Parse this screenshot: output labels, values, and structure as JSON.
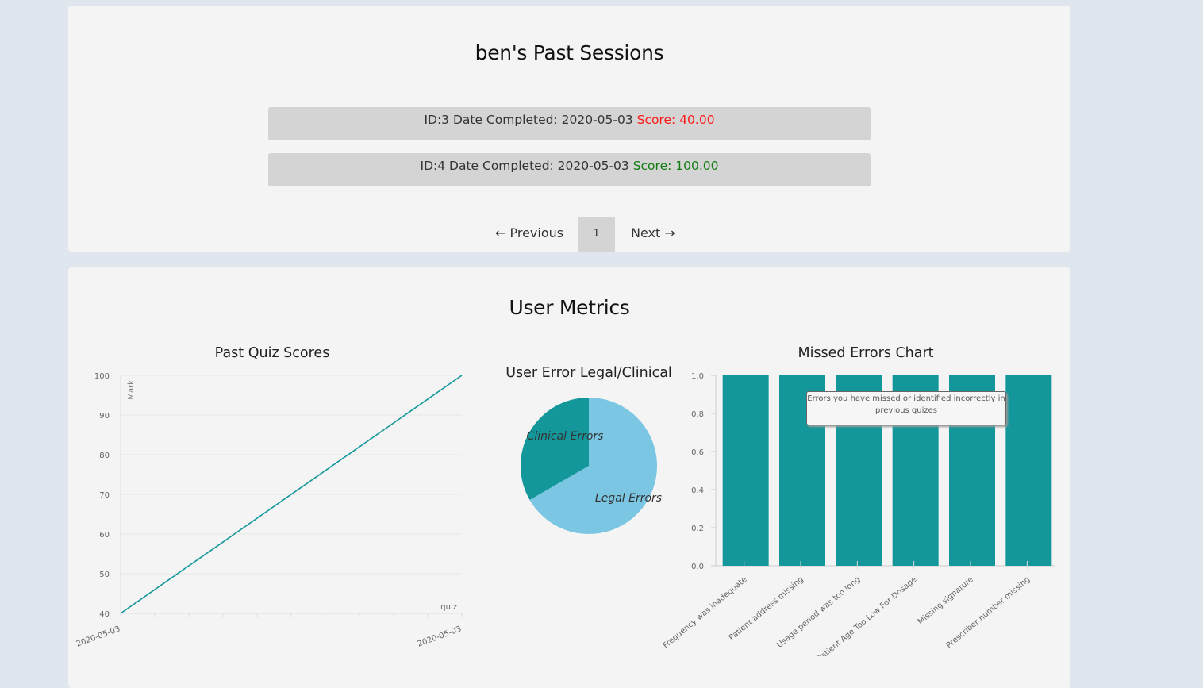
{
  "sessions": {
    "title": "ben's Past Sessions",
    "rows": [
      {
        "info": "ID:3 Date Completed: 2020-05-03 ",
        "score": "Score: 40.00"
      },
      {
        "info": "ID:4 Date Completed: 2020-05-03 ",
        "score": "Score: 100.00"
      }
    ],
    "pager": {
      "previous": "← Previous",
      "page": "1",
      "next": "Next →"
    }
  },
  "metrics": {
    "title": "User Metrics",
    "tooltip": "Errors you have missed or identified incorrectly in previous quizes"
  },
  "colors": {
    "teal": "#14979b",
    "light_blue": "#7bc6e3",
    "fail": "#ff1a1a",
    "pass": "#137d13"
  },
  "chart_data": [
    {
      "type": "line",
      "title": "Past Quiz Scores",
      "ylabel": "Mark",
      "xlabel": "quiz",
      "x": [
        "2020-05-03",
        "2020-05-03"
      ],
      "values": [
        40,
        100
      ],
      "ylim": [
        40,
        100
      ],
      "yticks": [
        "100",
        "90",
        "80",
        "70",
        "60",
        "50",
        "40"
      ],
      "grid": true
    },
    {
      "type": "pie",
      "title": "User Error Legal/Clinical",
      "labels": [
        "Legal Errors",
        "Clinical Errors"
      ],
      "values": [
        2,
        1
      ]
    },
    {
      "type": "bar",
      "title": "Missed Errors Chart",
      "categories": [
        "Frequency was inadequate",
        "Patient address missing",
        "Usage period was too long",
        "Patient Age Too Low For Dosage",
        "Missing signature",
        "Prescriber number missing"
      ],
      "values": [
        1.0,
        1.0,
        1.0,
        1.0,
        1.0,
        1.0
      ],
      "ylim": [
        0,
        1.0
      ],
      "yticks": [
        "1.0",
        "0.8",
        "0.6",
        "0.4",
        "0.2",
        "0.0"
      ],
      "grid": false
    }
  ]
}
